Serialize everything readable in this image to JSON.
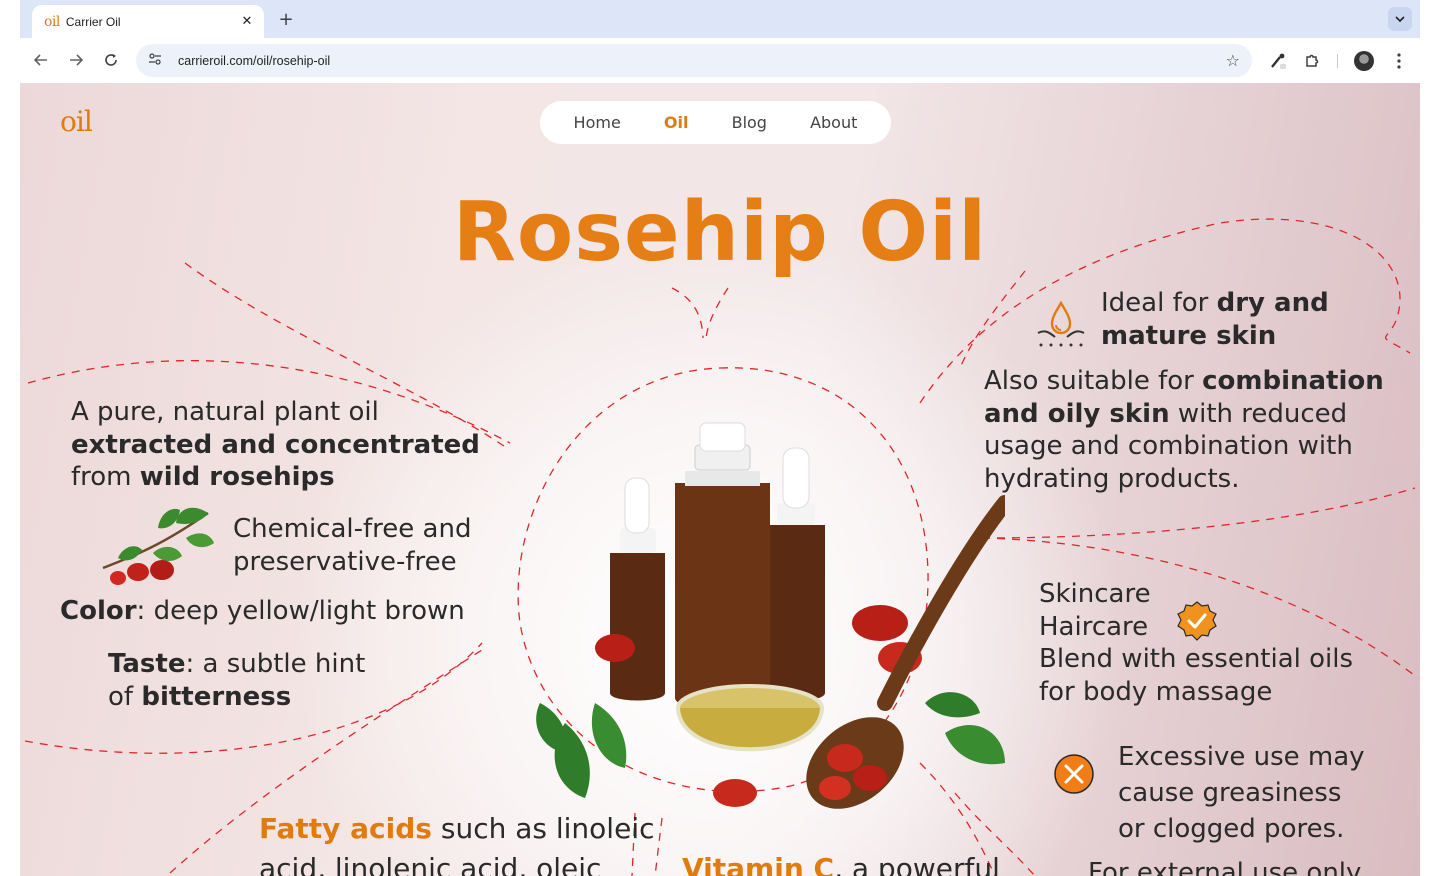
{
  "browser": {
    "tab_title": "Carrier Oil",
    "tab_favicon": "oil",
    "url": "carrieroil.com/oil/rosehip-oil"
  },
  "site": {
    "logo": "oil",
    "nav": [
      "Home",
      "Oil",
      "Blog",
      "About"
    ],
    "active_nav": "Oil"
  },
  "hero": {
    "title": "Rosehip Oil"
  },
  "left": {
    "intro": {
      "t1": "A pure, natural plant oil",
      "b1": "extracted and concentrated",
      "t2": "from ",
      "b2": "wild rosehips"
    },
    "chemical_free": [
      "Chemical-free and",
      "preservative-free"
    ],
    "color": {
      "label": "Color",
      "value": ": deep yellow/light brown"
    },
    "taste": {
      "label": "Taste",
      "value": ": a subtle hint",
      "t2": "of ",
      "b2": "bitterness"
    }
  },
  "right": {
    "ideal": {
      "t1": "Ideal for ",
      "b1": "dry and",
      "b2": "mature skin"
    },
    "suitable": {
      "t1": "Also suitable for ",
      "b1": "combination",
      "b2": "and oily skin",
      "t2": " with reduced",
      "t3": "usage and combination with",
      "t4": "hydrating products."
    },
    "uses": [
      "Skincare",
      "Haircare",
      "Blend with essential oils",
      "for body massage"
    ],
    "warning": [
      "Excessive use may",
      "cause greasiness",
      "or clogged pores."
    ],
    "external": "For external use only"
  },
  "bottom": {
    "fatty": {
      "b": "Fatty acids",
      "t1": " such as linoleic",
      "t2": "acid, linolenic acid, oleic"
    },
    "vitamin": {
      "b": "Vitamin C",
      "t": ", a powerful"
    }
  },
  "colors": {
    "accent": "#e07b10",
    "dash": "#e0262a"
  },
  "icons": [
    "drop-skin-icon",
    "verified-badge-icon",
    "warning-x-icon",
    "rosehip-branch-icon"
  ]
}
